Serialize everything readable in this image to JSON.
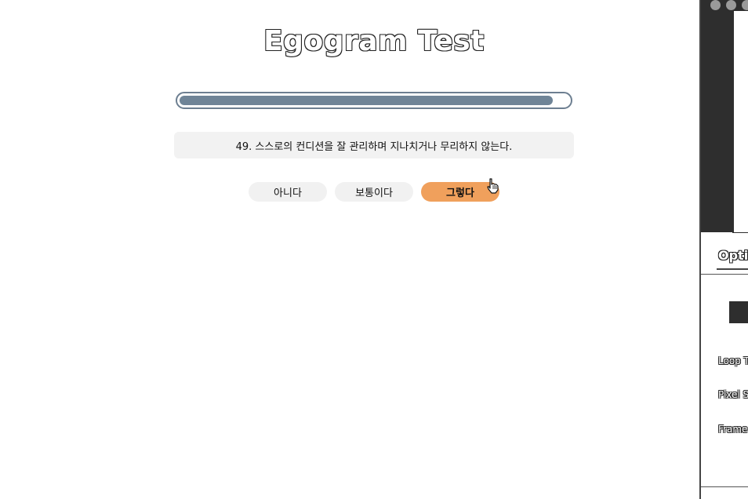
{
  "app": {
    "title": "Egogram Test"
  },
  "progress": {
    "value": 0.96
  },
  "question": {
    "text": "49. 스스로의 컨디션을 잘 관리하며 지나치거나 무리하지 않는다."
  },
  "answers": [
    {
      "label": "아니다",
      "selected": false
    },
    {
      "label": "보통이다",
      "selected": false
    },
    {
      "label": "그렇다",
      "selected": true
    }
  ],
  "side_panel": {
    "tab_label": "Optio",
    "labels": [
      "Loop T",
      "Pixel S",
      "Frame"
    ]
  },
  "colors": {
    "progress_fill": "#6f8497",
    "selected_answer": "#f0a05c",
    "answer_default": "#f1f1f1",
    "question_bg": "#f2f2f2"
  }
}
